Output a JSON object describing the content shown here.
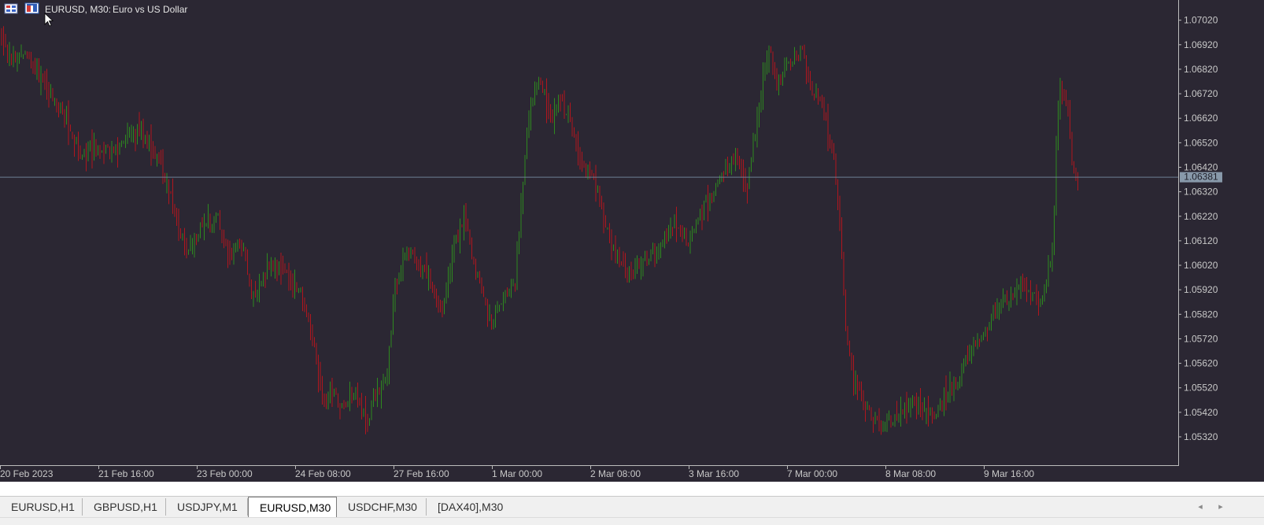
{
  "chart_header": {
    "symbol_caption": "EURUSD, M30:",
    "description": "Euro vs US Dollar",
    "icons": [
      "trade-panel-icon",
      "one-click-trading-icon"
    ]
  },
  "colors": {
    "background": "#2b2733",
    "bull": "#2e8a1f",
    "bear": "#b0161e",
    "axis_text": "#c8c8c8",
    "bid_line": "#6e7f94",
    "bid_label_bg": "#8899aa"
  },
  "tabs": [
    {
      "label": "EURUSD,H1",
      "active": false
    },
    {
      "label": "GBPUSD,H1",
      "active": false
    },
    {
      "label": "USDJPY,M1",
      "active": false
    },
    {
      "label": "EURUSD,M30",
      "active": true
    },
    {
      "label": "USDCHF,M30",
      "active": false
    },
    {
      "label": "[DAX40],M30",
      "active": false
    }
  ],
  "tab_scroll": {
    "left": "◂",
    "right": "▸"
  },
  "chart_data": {
    "type": "bar",
    "symbol": "EURUSD",
    "timeframe": "M30",
    "ylim": [
      1.0523,
      1.0708
    ],
    "y_ticks": [
      "1.07020",
      "1.06920",
      "1.06820",
      "1.06720",
      "1.06620",
      "1.06520",
      "1.06420",
      "1.06320",
      "1.06220",
      "1.06120",
      "1.06020",
      "1.05920",
      "1.05820",
      "1.05720",
      "1.05620",
      "1.05520",
      "1.05420",
      "1.05320"
    ],
    "x_ticks": [
      "20 Feb 2023",
      "21 Feb 16:00",
      "23 Feb 00:00",
      "24 Feb 08:00",
      "27 Feb 16:00",
      "1 Mar 00:00",
      "2 Mar 08:00",
      "3 Mar 16:00",
      "7 Mar 00:00",
      "8 Mar 08:00",
      "9 Mar 16:00"
    ],
    "current_price": "1.06381",
    "bar_count": 548,
    "close_path": [
      [
        0,
        1.0695
      ],
      [
        12,
        1.0685
      ],
      [
        30,
        1.0688
      ],
      [
        55,
        1.0676
      ],
      [
        80,
        1.0662
      ],
      [
        100,
        1.0647
      ],
      [
        118,
        1.065
      ],
      [
        140,
        1.0648
      ],
      [
        165,
        1.0658
      ],
      [
        185,
        1.0655
      ],
      [
        210,
        1.0636
      ],
      [
        235,
        1.0609
      ],
      [
        255,
        1.0617
      ],
      [
        275,
        1.0622
      ],
      [
        290,
        1.0605
      ],
      [
        305,
        1.0612
      ],
      [
        320,
        1.0588
      ],
      [
        340,
        1.0603
      ],
      [
        360,
        1.0598
      ],
      [
        380,
        1.0592
      ],
      [
        400,
        1.0566
      ],
      [
        410,
        1.0546
      ],
      [
        420,
        1.0553
      ],
      [
        435,
        1.0544
      ],
      [
        450,
        1.0551
      ],
      [
        465,
        1.0537
      ],
      [
        475,
        1.0548
      ],
      [
        490,
        1.0554
      ],
      [
        500,
        1.059
      ],
      [
        515,
        1.0609
      ],
      [
        530,
        1.0603
      ],
      [
        545,
        1.0595
      ],
      [
        560,
        1.0582
      ],
      [
        575,
        1.0608
      ],
      [
        590,
        1.0622
      ],
      [
        600,
        1.0606
      ],
      [
        612,
        1.0592
      ],
      [
        625,
        1.0576
      ],
      [
        640,
        1.0591
      ],
      [
        655,
        1.0596
      ],
      [
        665,
        1.0638
      ],
      [
        675,
        1.0669
      ],
      [
        685,
        1.068
      ],
      [
        700,
        1.0661
      ],
      [
        712,
        1.067
      ],
      [
        725,
        1.066
      ],
      [
        740,
        1.0643
      ],
      [
        755,
        1.0637
      ],
      [
        770,
        1.062
      ],
      [
        785,
        1.0603
      ],
      [
        800,
        1.0598
      ],
      [
        815,
        1.0604
      ],
      [
        830,
        1.0607
      ],
      [
        845,
        1.0614
      ],
      [
        860,
        1.0619
      ],
      [
        875,
        1.0612
      ],
      [
        890,
        1.0624
      ],
      [
        905,
        1.063
      ],
      [
        920,
        1.0641
      ],
      [
        935,
        1.0646
      ],
      [
        950,
        1.0634
      ],
      [
        965,
        1.0667
      ],
      [
        978,
        1.069
      ],
      [
        990,
        1.0677
      ],
      [
        1005,
        1.0684
      ],
      [
        1020,
        1.0689
      ],
      [
        1035,
        1.0672
      ],
      [
        1050,
        1.0663
      ],
      [
        1060,
        1.0647
      ],
      [
        1068,
        1.0625
      ],
      [
        1075,
        1.058
      ],
      [
        1085,
        1.0555
      ],
      [
        1100,
        1.0546
      ],
      [
        1115,
        1.0537
      ],
      [
        1130,
        1.0538
      ],
      [
        1145,
        1.0542
      ],
      [
        1160,
        1.0546
      ],
      [
        1175,
        1.0544
      ],
      [
        1190,
        1.0541
      ],
      [
        1205,
        1.055
      ],
      [
        1220,
        1.0556
      ],
      [
        1235,
        1.0566
      ],
      [
        1250,
        1.0574
      ],
      [
        1265,
        1.0582
      ],
      [
        1280,
        1.0588
      ],
      [
        1295,
        1.0593
      ],
      [
        1310,
        1.059
      ],
      [
        1325,
        1.0589
      ],
      [
        1340,
        1.0606
      ],
      [
        1345,
        1.0659
      ],
      [
        1350,
        1.0678
      ],
      [
        1358,
        1.0668
      ],
      [
        1365,
        1.0643
      ],
      [
        1372,
        1.0639
      ]
    ]
  }
}
